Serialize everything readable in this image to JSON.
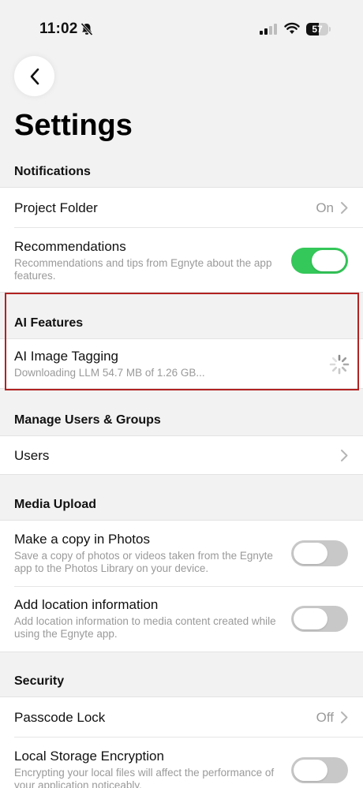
{
  "status_bar": {
    "time": "11:02",
    "battery": "57",
    "battery_level": 0.57
  },
  "header": {
    "title": "Settings"
  },
  "sections": {
    "notifications": {
      "header": "Notifications",
      "project_folder": {
        "title": "Project Folder",
        "value": "On"
      },
      "recommendations": {
        "title": "Recommendations",
        "subtitle": "Recommendations and tips from Egnyte about the app features.",
        "enabled": true
      }
    },
    "ai_features": {
      "header": "AI Features",
      "ai_image_tagging": {
        "title": "AI Image Tagging",
        "subtitle": "Downloading LLM 54.7 MB of 1.26 GB..."
      }
    },
    "manage_users": {
      "header": "Manage Users & Groups",
      "users": {
        "title": "Users"
      }
    },
    "media_upload": {
      "header": "Media Upload",
      "copy_in_photos": {
        "title": "Make a copy in Photos",
        "subtitle": "Save a copy of photos or videos taken from the Egnyte app to the Photos Library on your device.",
        "enabled": false
      },
      "location_info": {
        "title": "Add location information",
        "subtitle": "Add location information to media content created while using the Egnyte app.",
        "enabled": false
      }
    },
    "security": {
      "header": "Security",
      "passcode_lock": {
        "title": "Passcode Lock",
        "value": "Off"
      },
      "local_storage_encryption": {
        "title": "Local Storage Encryption",
        "subtitle": "Encrypting your local files will affect the performance of your application noticeably.",
        "enabled": false
      }
    }
  },
  "colors": {
    "toggle_on": "#34c759",
    "toggle_off": "#c8c8c8",
    "highlight": "#b22222"
  }
}
